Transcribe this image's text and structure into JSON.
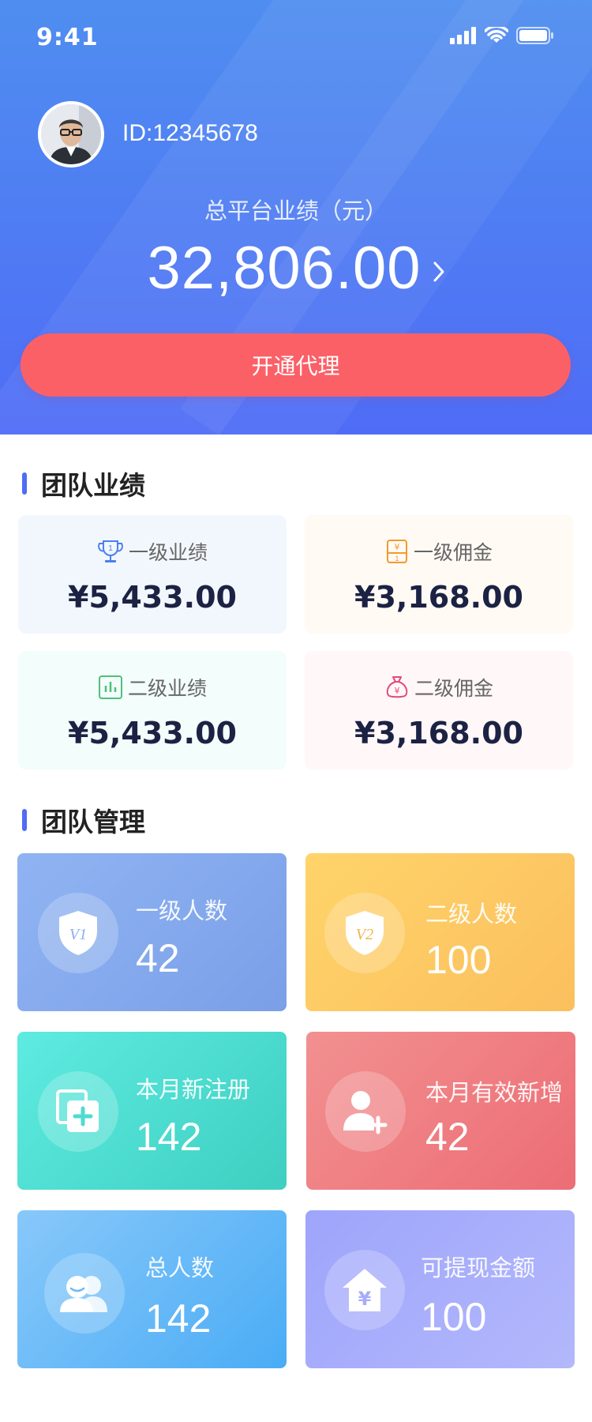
{
  "status": {
    "time": "9:41"
  },
  "user": {
    "id": "ID:12345678"
  },
  "total": {
    "label": "总平台业绩（元）",
    "value": "32,806.00"
  },
  "agent_button": "开通代理",
  "colors": {
    "header_top": "#4f8ef0",
    "header_bottom": "#4f6cf6",
    "agent_button": "#fb6067",
    "accent": "#4f6cf6"
  },
  "team_performance": {
    "title": "团队业绩",
    "cards": [
      {
        "label": "一级业绩",
        "value": "¥5,433.00",
        "icon": "trophy-icon"
      },
      {
        "label": "一级佣金",
        "value": "¥3,168.00",
        "icon": "yen-box-icon"
      },
      {
        "label": "二级业绩",
        "value": "¥5,433.00",
        "icon": "bar-chart-icon"
      },
      {
        "label": "二级佣金",
        "value": "¥3,168.00",
        "icon": "money-bag-icon"
      }
    ]
  },
  "team_management": {
    "title": "团队管理",
    "cards": [
      {
        "label": "一级人数",
        "value": "42",
        "icon": "shield-v1-icon",
        "badge": "V1"
      },
      {
        "label": "二级人数",
        "value": "100",
        "icon": "shield-v2-icon",
        "badge": "V2"
      },
      {
        "label": "本月新注册",
        "value": "142",
        "icon": "add-document-icon"
      },
      {
        "label": "本月有效新增",
        "value": "42",
        "icon": "add-user-icon"
      },
      {
        "label": "总人数",
        "value": "142",
        "icon": "users-icon"
      },
      {
        "label": "可提现金额",
        "value": "100",
        "icon": "yen-house-icon"
      }
    ]
  }
}
